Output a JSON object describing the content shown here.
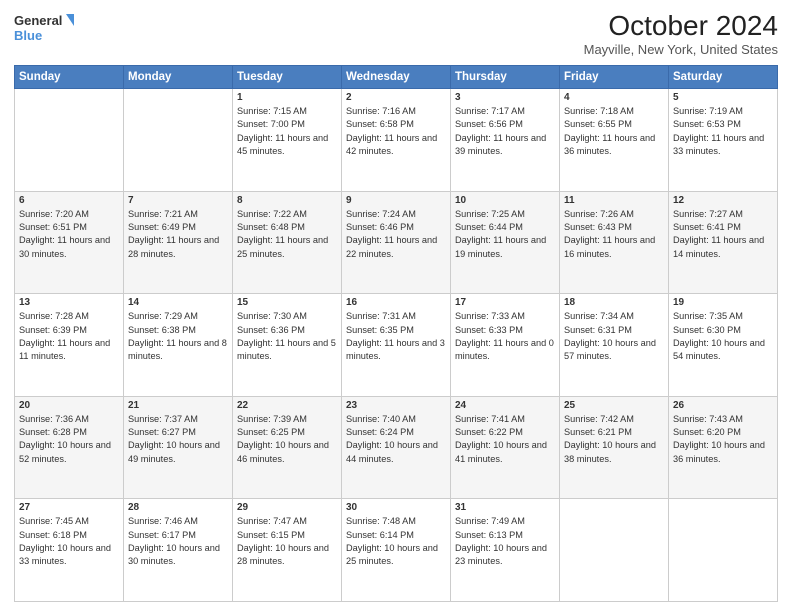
{
  "header": {
    "logo_line1": "General",
    "logo_line2": "Blue",
    "title": "October 2024",
    "subtitle": "Mayville, New York, United States"
  },
  "weekdays": [
    "Sunday",
    "Monday",
    "Tuesday",
    "Wednesday",
    "Thursday",
    "Friday",
    "Saturday"
  ],
  "weeks": [
    [
      {
        "day": "",
        "info": ""
      },
      {
        "day": "",
        "info": ""
      },
      {
        "day": "1",
        "info": "Sunrise: 7:15 AM\nSunset: 7:00 PM\nDaylight: 11 hours and 45 minutes."
      },
      {
        "day": "2",
        "info": "Sunrise: 7:16 AM\nSunset: 6:58 PM\nDaylight: 11 hours and 42 minutes."
      },
      {
        "day": "3",
        "info": "Sunrise: 7:17 AM\nSunset: 6:56 PM\nDaylight: 11 hours and 39 minutes."
      },
      {
        "day": "4",
        "info": "Sunrise: 7:18 AM\nSunset: 6:55 PM\nDaylight: 11 hours and 36 minutes."
      },
      {
        "day": "5",
        "info": "Sunrise: 7:19 AM\nSunset: 6:53 PM\nDaylight: 11 hours and 33 minutes."
      }
    ],
    [
      {
        "day": "6",
        "info": "Sunrise: 7:20 AM\nSunset: 6:51 PM\nDaylight: 11 hours and 30 minutes."
      },
      {
        "day": "7",
        "info": "Sunrise: 7:21 AM\nSunset: 6:49 PM\nDaylight: 11 hours and 28 minutes."
      },
      {
        "day": "8",
        "info": "Sunrise: 7:22 AM\nSunset: 6:48 PM\nDaylight: 11 hours and 25 minutes."
      },
      {
        "day": "9",
        "info": "Sunrise: 7:24 AM\nSunset: 6:46 PM\nDaylight: 11 hours and 22 minutes."
      },
      {
        "day": "10",
        "info": "Sunrise: 7:25 AM\nSunset: 6:44 PM\nDaylight: 11 hours and 19 minutes."
      },
      {
        "day": "11",
        "info": "Sunrise: 7:26 AM\nSunset: 6:43 PM\nDaylight: 11 hours and 16 minutes."
      },
      {
        "day": "12",
        "info": "Sunrise: 7:27 AM\nSunset: 6:41 PM\nDaylight: 11 hours and 14 minutes."
      }
    ],
    [
      {
        "day": "13",
        "info": "Sunrise: 7:28 AM\nSunset: 6:39 PM\nDaylight: 11 hours and 11 minutes."
      },
      {
        "day": "14",
        "info": "Sunrise: 7:29 AM\nSunset: 6:38 PM\nDaylight: 11 hours and 8 minutes."
      },
      {
        "day": "15",
        "info": "Sunrise: 7:30 AM\nSunset: 6:36 PM\nDaylight: 11 hours and 5 minutes."
      },
      {
        "day": "16",
        "info": "Sunrise: 7:31 AM\nSunset: 6:35 PM\nDaylight: 11 hours and 3 minutes."
      },
      {
        "day": "17",
        "info": "Sunrise: 7:33 AM\nSunset: 6:33 PM\nDaylight: 11 hours and 0 minutes."
      },
      {
        "day": "18",
        "info": "Sunrise: 7:34 AM\nSunset: 6:31 PM\nDaylight: 10 hours and 57 minutes."
      },
      {
        "day": "19",
        "info": "Sunrise: 7:35 AM\nSunset: 6:30 PM\nDaylight: 10 hours and 54 minutes."
      }
    ],
    [
      {
        "day": "20",
        "info": "Sunrise: 7:36 AM\nSunset: 6:28 PM\nDaylight: 10 hours and 52 minutes."
      },
      {
        "day": "21",
        "info": "Sunrise: 7:37 AM\nSunset: 6:27 PM\nDaylight: 10 hours and 49 minutes."
      },
      {
        "day": "22",
        "info": "Sunrise: 7:39 AM\nSunset: 6:25 PM\nDaylight: 10 hours and 46 minutes."
      },
      {
        "day": "23",
        "info": "Sunrise: 7:40 AM\nSunset: 6:24 PM\nDaylight: 10 hours and 44 minutes."
      },
      {
        "day": "24",
        "info": "Sunrise: 7:41 AM\nSunset: 6:22 PM\nDaylight: 10 hours and 41 minutes."
      },
      {
        "day": "25",
        "info": "Sunrise: 7:42 AM\nSunset: 6:21 PM\nDaylight: 10 hours and 38 minutes."
      },
      {
        "day": "26",
        "info": "Sunrise: 7:43 AM\nSunset: 6:20 PM\nDaylight: 10 hours and 36 minutes."
      }
    ],
    [
      {
        "day": "27",
        "info": "Sunrise: 7:45 AM\nSunset: 6:18 PM\nDaylight: 10 hours and 33 minutes."
      },
      {
        "day": "28",
        "info": "Sunrise: 7:46 AM\nSunset: 6:17 PM\nDaylight: 10 hours and 30 minutes."
      },
      {
        "day": "29",
        "info": "Sunrise: 7:47 AM\nSunset: 6:15 PM\nDaylight: 10 hours and 28 minutes."
      },
      {
        "day": "30",
        "info": "Sunrise: 7:48 AM\nSunset: 6:14 PM\nDaylight: 10 hours and 25 minutes."
      },
      {
        "day": "31",
        "info": "Sunrise: 7:49 AM\nSunset: 6:13 PM\nDaylight: 10 hours and 23 minutes."
      },
      {
        "day": "",
        "info": ""
      },
      {
        "day": "",
        "info": ""
      }
    ]
  ]
}
